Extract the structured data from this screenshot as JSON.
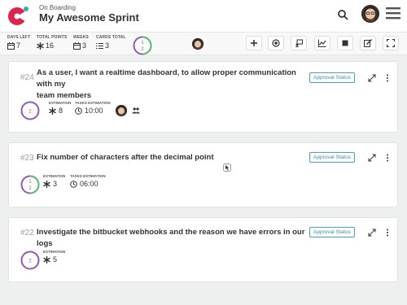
{
  "header": {
    "project_subtitle": "On Boarding",
    "sprint_title": "My Awesome Sprint",
    "icons": {
      "logo": "app-logo",
      "search": "search-icon",
      "avatar": "user-avatar",
      "menu": "hamburger-menu-icon"
    }
  },
  "stats": {
    "days_left": {
      "label": "DAYS LEFT",
      "value": "7",
      "icon": "calendar-icon"
    },
    "total_points": {
      "label": "TOTAL POINTS",
      "value": "16",
      "icon": "asterisk-icon"
    },
    "weeks": {
      "label": "WEEKS",
      "value": "3",
      "icon": "calendar-icon"
    },
    "cards_total": {
      "label": "CARDS TOTAL",
      "value": "3",
      "icon": "list-icon"
    },
    "sprint_progress": {
      "top": "1",
      "bottom": "2",
      "done_fraction": 0.5
    },
    "toolbar_icons": [
      "add-icon",
      "target-icon",
      "assign-icon",
      "chart-icon",
      "stop-icon",
      "edit-icon",
      "fullscreen-icon"
    ]
  },
  "cards": [
    {
      "number": "#24",
      "title_line1": "As a user, I want a realtime dashboard, to allow proper communication with my",
      "title_line2": "team members",
      "approval_label": "Approval Status",
      "points_top": "",
      "points_bottom": "2",
      "done_fraction": 0,
      "estimation_label": "ESTIMATION",
      "estimation_value": "8",
      "tasks_label": "TASKS ESTIMATION",
      "tasks_value": "10:00"
    },
    {
      "number": "#23",
      "title_line1": "Fix number of characters after the decimal point",
      "approval_label": "Approval Status",
      "points_top": "1",
      "points_bottom": "2",
      "done_fraction": 0.5,
      "estimation_label": "ESTIMATION",
      "estimation_value": "3",
      "tasks_label": "TASKS ESTIMATION",
      "tasks_value": "06:00"
    },
    {
      "number": "#22",
      "title_line1": "Investigate the bitbucket webhooks and the reason we have errors in our logs",
      "approval_label": "Approval Status",
      "points_top": "",
      "points_bottom": "2",
      "done_fraction": 0,
      "estimation_label": "ESTIMATION",
      "estimation_value": "5"
    }
  ],
  "colors": {
    "accent_purple": "#8e5bb8",
    "ring_green": "#5cbf72",
    "approval_blue": "#3b8fb3",
    "logo_red": "#e0234e"
  }
}
